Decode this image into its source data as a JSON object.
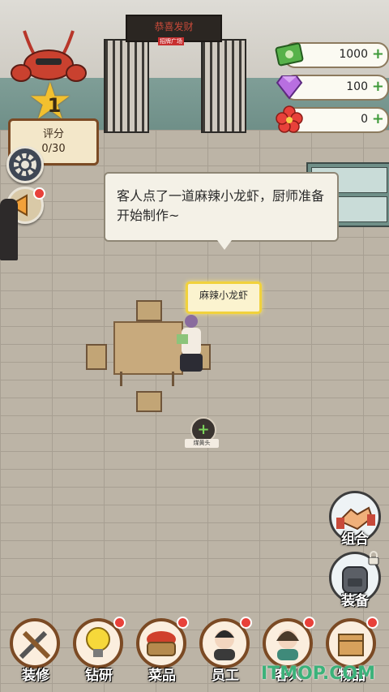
{
  "storefront": {
    "sign_text": "恭喜发财",
    "sign_sub": "招牌广场"
  },
  "player": {
    "level": "1",
    "rating_label": "评分",
    "rating_value": "0/30"
  },
  "currencies": [
    {
      "name": "cash",
      "icon": "money-icon",
      "value": "1000"
    },
    {
      "name": "gem",
      "icon": "diamond-icon",
      "value": "100"
    },
    {
      "name": "flower",
      "icon": "flower-icon",
      "value": "0"
    }
  ],
  "dialog": {
    "text": "客人点了一道麻辣小龙虾，厨师准备开始制作~"
  },
  "order": {
    "dish": "麻辣小龙虾"
  },
  "station_label": "煤黄头",
  "right_actions": [
    {
      "label": "组合",
      "icon": "handshake-icon"
    },
    {
      "label": "装备",
      "icon": "backpack-icon"
    }
  ],
  "bottom_nav": [
    {
      "label": "装修",
      "icon": "hammer-wrench-icon",
      "badge": false
    },
    {
      "label": "钻研",
      "icon": "lightbulb-icon",
      "badge": true
    },
    {
      "label": "菜品",
      "icon": "crayfish-basket-icon",
      "badge": true
    },
    {
      "label": "员工",
      "icon": "staff-portrait-icon",
      "badge": true
    },
    {
      "label": "客人",
      "icon": "guest-portrait-icon",
      "badge": true
    },
    {
      "label": "物品",
      "icon": "box-icon",
      "badge": true
    }
  ],
  "watermark": "ITMOP.COM",
  "colors": {
    "accent_gold": "#f2c02f",
    "badge_red": "#e8413a",
    "plus_green": "#3f9a3a"
  }
}
